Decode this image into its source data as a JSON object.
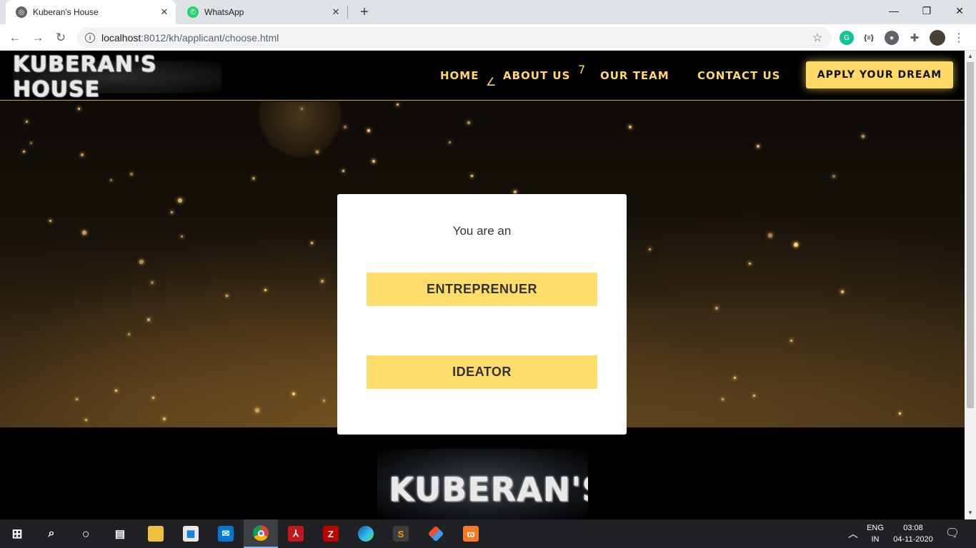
{
  "browser": {
    "tabs": [
      {
        "title": "Kuberan's House",
        "favicon": "globe-icon",
        "active": true
      },
      {
        "title": "WhatsApp",
        "favicon": "whatsapp-icon",
        "active": false
      }
    ],
    "url_host": "localhost",
    "url_rest": ":8012/kh/applicant/choose.html"
  },
  "site": {
    "logo_text": "KUBERAN'S HOUSE",
    "nav": [
      "HOME",
      "ABOUT US",
      "OUR TEAM",
      "CONTACT US"
    ],
    "apply_button": "APPLY YOUR DREAM",
    "card": {
      "prompt": "You are an",
      "options": [
        "ENTREPRENUER",
        "IDEATOR"
      ]
    },
    "footer_logo_text": "KUBERAN'S HOUSE"
  },
  "taskbar": {
    "language_top": "ENG",
    "language_bottom": "IN",
    "time": "03:08",
    "date": "04-11-2020",
    "apps": [
      "windows-start",
      "search",
      "cortana",
      "task-view",
      "file-explorer",
      "store",
      "mail",
      "chrome",
      "acrobat",
      "filezilla",
      "edge",
      "sublime-text",
      "git",
      "xampp"
    ]
  },
  "colors": {
    "accent": "#ffd966",
    "page_bg": "#000000",
    "card_bg": "#ffffff"
  }
}
